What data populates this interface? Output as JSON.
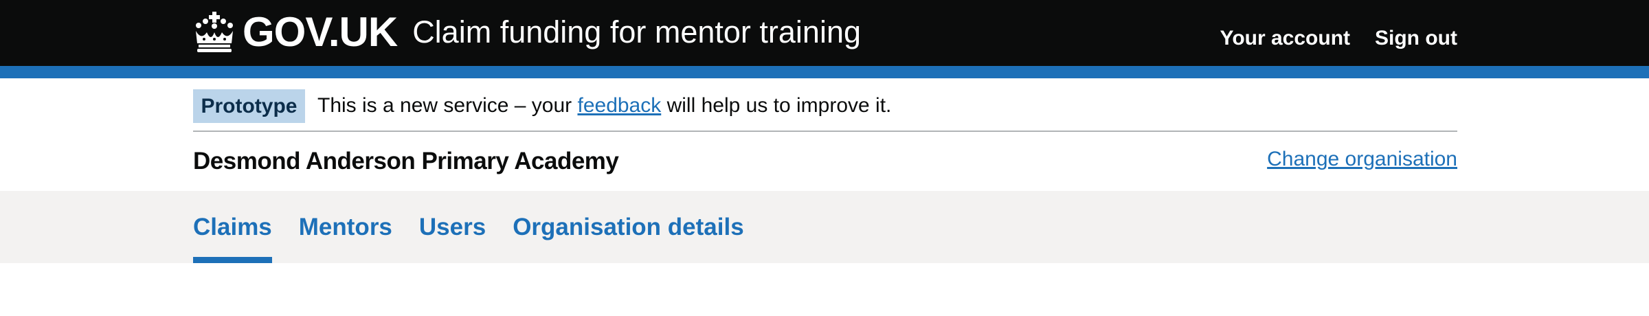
{
  "header": {
    "logotype": "GOV.UK",
    "service_name": "Claim funding for mentor training",
    "nav": [
      {
        "label": "Your account"
      },
      {
        "label": "Sign out"
      }
    ],
    "crown_icon": "crown-icon"
  },
  "phase_banner": {
    "tag": "Prototype",
    "text_before": "This is a new service – your ",
    "link": "feedback",
    "text_after": " will help us to improve it."
  },
  "organisation": {
    "name": "Desmond Anderson Primary Academy",
    "change_link": "Change organisation"
  },
  "primary_nav": {
    "items": [
      {
        "label": "Claims",
        "active": true
      },
      {
        "label": "Mentors",
        "active": false
      },
      {
        "label": "Users",
        "active": false
      },
      {
        "label": "Organisation details",
        "active": false
      }
    ]
  },
  "colors": {
    "header_bg": "#0b0c0c",
    "brand_blue": "#1d70b8",
    "tag_bg": "#bbd4ea",
    "nav_bg": "#f3f2f1"
  }
}
